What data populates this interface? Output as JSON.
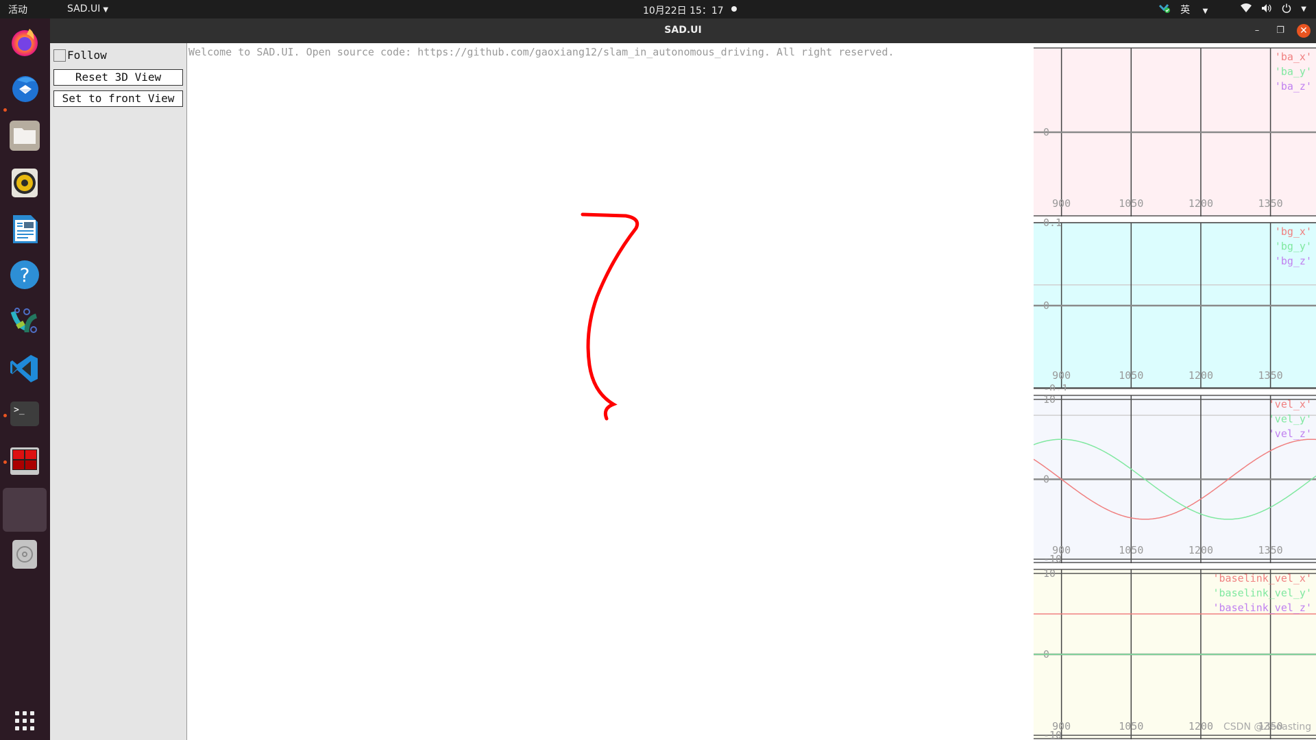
{
  "topbar": {
    "activities": "活动",
    "app_menu": "SAD.UI",
    "clock": "10月22日  15：17",
    "input_method": "英",
    "tray_icons": [
      "vpn-status-icon",
      "input-method-icon",
      "wifi-icon",
      "volume-icon",
      "power-icon"
    ]
  },
  "window": {
    "title": "SAD.UI",
    "buttons": [
      "minimize",
      "maximize",
      "close"
    ]
  },
  "dock": {
    "items": [
      {
        "name": "firefox",
        "running": false
      },
      {
        "name": "thunderbird",
        "running": false
      },
      {
        "name": "files",
        "running": true
      },
      {
        "name": "rhythmbox",
        "running": false
      },
      {
        "name": "libreoffice-writer",
        "running": false
      },
      {
        "name": "help",
        "running": false
      },
      {
        "name": "inkscape",
        "running": false
      },
      {
        "name": "vscode",
        "running": false
      },
      {
        "name": "terminal",
        "running": true
      },
      {
        "name": "terminator",
        "running": true
      },
      {
        "name": "sad-ui",
        "running": true
      },
      {
        "name": "disc",
        "running": false
      }
    ],
    "show_apps": "show-applications"
  },
  "panel": {
    "follow_label": "Follow",
    "follow_checked": false,
    "reset_label": "Reset 3D View",
    "front_label": "Set to front View"
  },
  "view3d": {
    "welcome": "Welcome to SAD.UI. Open source code: https://github.com/gaoxiang12/slam_in_autonomous_driving. All right reserved.",
    "trajectory_color": "#ff0000"
  },
  "chart_data": [
    {
      "type": "line",
      "title": "",
      "background": "#fff0f3",
      "x_ticks": [
        900,
        1050,
        1200,
        1350
      ],
      "y_ticks": [
        {
          "value": 0,
          "label": "0"
        }
      ],
      "xlim": [
        840,
        1448
      ],
      "ylim": [
        -0.1,
        0.1
      ],
      "legend": [
        "'ba_x'",
        "'ba_y'",
        "'ba_z'"
      ],
      "legend_position": "top-right",
      "series": []
    },
    {
      "type": "line",
      "title": "",
      "background": "#dcfdfe",
      "x_ticks": [
        900,
        1050,
        1200,
        1350
      ],
      "y_ticks": [
        {
          "value": 0.1,
          "label": "0.1"
        },
        {
          "value": 0,
          "label": "0"
        },
        {
          "value": -0.1,
          "label": "-0.1"
        }
      ],
      "xlim": [
        840,
        1448
      ],
      "ylim": [
        -0.1,
        0.1
      ],
      "ref_line": 0.025,
      "legend": [
        "'bg_x'",
        "'bg_y'",
        "'bg_z'"
      ],
      "legend_position": "top-right",
      "series": []
    },
    {
      "type": "line",
      "title": "",
      "background": "#f5f7fd",
      "x_ticks": [
        900,
        1050,
        1200,
        1350
      ],
      "y_ticks": [
        {
          "value": 10,
          "label": "10"
        },
        {
          "value": 0,
          "label": "0"
        },
        {
          "value": -10,
          "label": "-10"
        }
      ],
      "xlim": [
        840,
        1448
      ],
      "ylim": [
        -10.5,
        10.5
      ],
      "ref_line": 8,
      "legend": [
        "'vel_x'",
        "'vel_y'",
        "'vel_z'"
      ],
      "legend_position": "top-right",
      "series": [
        {
          "name": "vel_x",
          "color": "#f08080",
          "function": "sine",
          "amplitude": -5,
          "period": 718,
          "phase_x": 900
        },
        {
          "name": "vel_y",
          "color": "#80e8a0",
          "function": "cosine",
          "amplitude": 5,
          "period": 718,
          "phase_x": 900
        }
      ]
    },
    {
      "type": "line",
      "title": "",
      "background": "#fdfdee",
      "x_ticks": [
        900,
        1050,
        1200,
        1350
      ],
      "y_ticks": [
        {
          "value": 10,
          "label": "10"
        },
        {
          "value": 0,
          "label": "0"
        },
        {
          "value": -10,
          "label": "-10"
        }
      ],
      "xlim": [
        840,
        1448
      ],
      "ylim": [
        -10.5,
        10.5
      ],
      "legend": [
        "'baselink_vel_x'",
        "'baselink_vel_y'",
        "'baselink_vel_z'"
      ],
      "legend_position": "top-right",
      "series": [
        {
          "name": "baselink_vel_x",
          "color": "#f08080",
          "function": "constant",
          "value": 5
        },
        {
          "name": "baselink_vel_y",
          "color": "#80e8a0",
          "function": "constant",
          "value": 0
        }
      ]
    }
  ],
  "legend_colors": [
    "#f08080",
    "#80e8a0",
    "#c080f0"
  ],
  "watermark": "CSDN @Zeoasting"
}
